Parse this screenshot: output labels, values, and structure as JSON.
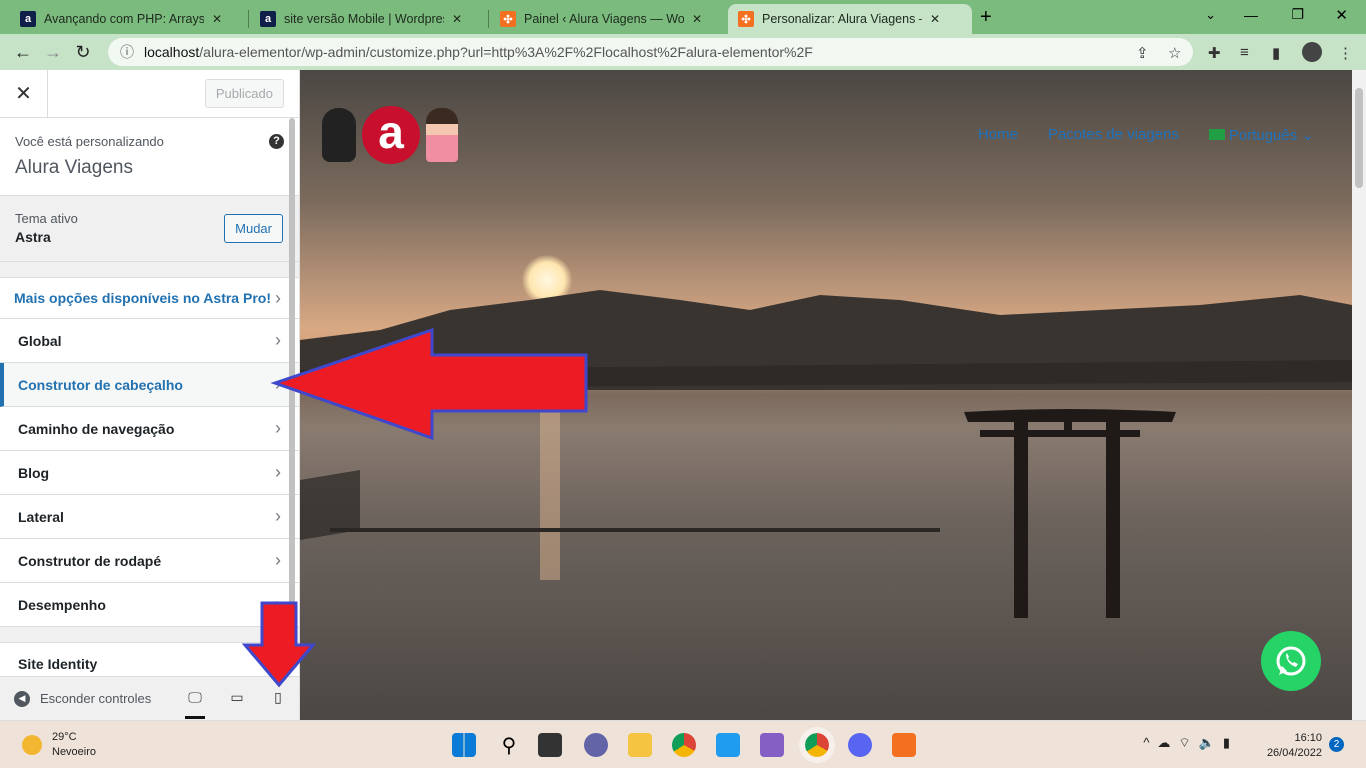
{
  "browser": {
    "tabs": [
      {
        "title": "Avançando com PHP: Arrays, Strings",
        "icon": "alura-icon",
        "color": "#0f1f4a"
      },
      {
        "title": "site versão Mobile | Wordpress: i",
        "icon": "alura-icon",
        "color": "#0f1f4a"
      },
      {
        "title": "Painel ‹ Alura Viagens — WordPr",
        "icon": "xampp-icon",
        "color": "#f37021"
      },
      {
        "title": "Personalizar: Alura Viagens – Só n",
        "icon": "xampp-icon",
        "color": "#f37021",
        "active": true
      }
    ],
    "url_host": "localhost",
    "url_path": "/alura-elementor/wp-admin/customize.php?url=http%3A%2F%2Flocalhost%2Falura-elementor%2F"
  },
  "customizer": {
    "publish_label": "Publicado",
    "customizing_label": "Você está personalizando",
    "site_name": "Alura Viagens",
    "active_theme_label": "Tema ativo",
    "theme_name": "Astra",
    "change_label": "Mudar",
    "pro_link": "Mais opções disponíveis no Astra Pro!",
    "sections": [
      "Global",
      "Construtor de cabeçalho",
      "Caminho de navegação",
      "Blog",
      "Lateral",
      "Construtor de rodapé",
      "Desempenho"
    ],
    "current_section": "Construtor de cabeçalho",
    "site_identity": "Site Identity",
    "hide_controls": "Esconder controles"
  },
  "preview": {
    "menu": [
      "Home",
      "Pacotes de viagens",
      "Português"
    ],
    "logo_letter": "a",
    "accent": "#1e73be"
  },
  "annotations": {
    "arrow_color": "#ed1c24",
    "arrow_border": "#3f48cc"
  },
  "taskbar": {
    "temp": "29°C",
    "weather": "Nevoeiro",
    "time": "16:10",
    "date": "26/04/2022",
    "notifications": "2"
  }
}
